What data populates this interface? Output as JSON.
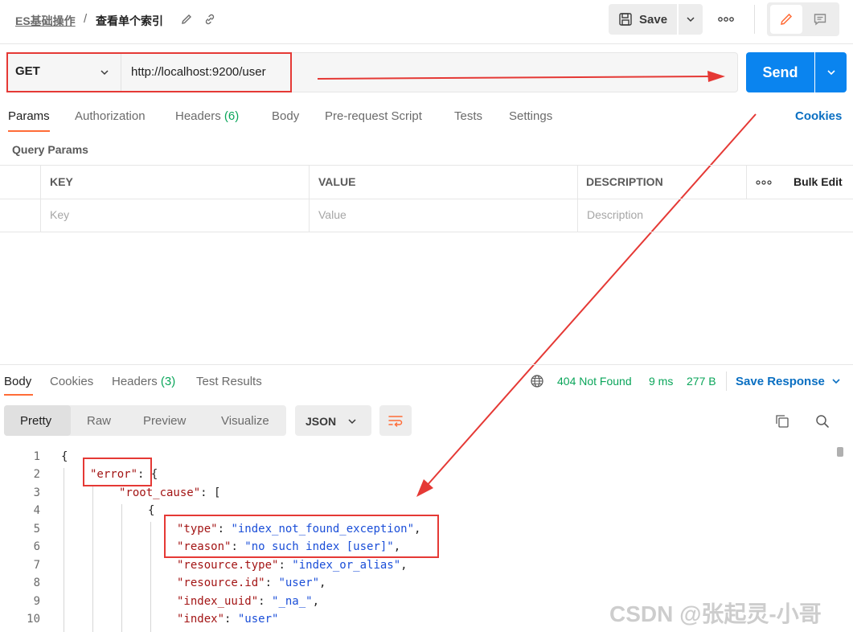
{
  "header": {
    "breadcrumb_parent": "ES基础操作",
    "breadcrumb_sep": "/",
    "request_title": "查看单个索引",
    "save_label": "Save"
  },
  "request": {
    "method": "GET",
    "url": "http://localhost:9200/user",
    "send_label": "Send"
  },
  "request_tabs": {
    "params": "Params",
    "authorization": "Authorization",
    "headers": "Headers",
    "headers_count": "(6)",
    "body": "Body",
    "pre_request": "Pre-request Script",
    "tests": "Tests",
    "settings": "Settings",
    "cookies": "Cookies"
  },
  "query_params": {
    "label": "Query Params",
    "columns": [
      "KEY",
      "VALUE",
      "DESCRIPTION"
    ],
    "bulk_edit": "Bulk Edit",
    "placeholders": [
      "Key",
      "Value",
      "Description"
    ]
  },
  "response_tabs": {
    "body": "Body",
    "cookies": "Cookies",
    "headers": "Headers",
    "headers_count": "(3)",
    "test_results": "Test Results"
  },
  "response_status": {
    "status": "404 Not Found",
    "time": "9 ms",
    "size": "277 B",
    "save_response": "Save Response"
  },
  "view_modes": {
    "pretty": "Pretty",
    "raw": "Raw",
    "preview": "Preview",
    "visualize": "Visualize",
    "format": "JSON"
  },
  "code_lines": [
    {
      "n": "1",
      "text": "{"
    },
    {
      "n": "2",
      "key": "\"error\"",
      "rest": ": {"
    },
    {
      "n": "3",
      "key": "\"root_cause\"",
      "rest": ": ["
    },
    {
      "n": "4",
      "text": "{"
    },
    {
      "n": "5",
      "key": "\"type\"",
      "sep": ": ",
      "val": "\"index_not_found_exception\"",
      "end": ","
    },
    {
      "n": "6",
      "key": "\"reason\"",
      "sep": ": ",
      "val": "\"no such index [user]\"",
      "end": ","
    },
    {
      "n": "7",
      "key": "\"resource.type\"",
      "sep": ": ",
      "val": "\"index_or_alias\"",
      "end": ","
    },
    {
      "n": "8",
      "key": "\"resource.id\"",
      "sep": ": ",
      "val": "\"user\"",
      "end": ","
    },
    {
      "n": "9",
      "key": "\"index_uuid\"",
      "sep": ": ",
      "val": "\"_na_\"",
      "end": ","
    },
    {
      "n": "10",
      "key": "\"index\"",
      "sep": ": ",
      "val": "\"user\"",
      "end": ""
    }
  ],
  "watermark": "CSDN @张起灵-小哥",
  "colors": {
    "accent_orange": "#ff6c37",
    "send_blue": "#0a84ef",
    "link_blue": "#0a6fc2",
    "status_green": "#0aa55a",
    "annotation_red": "#e53935"
  }
}
